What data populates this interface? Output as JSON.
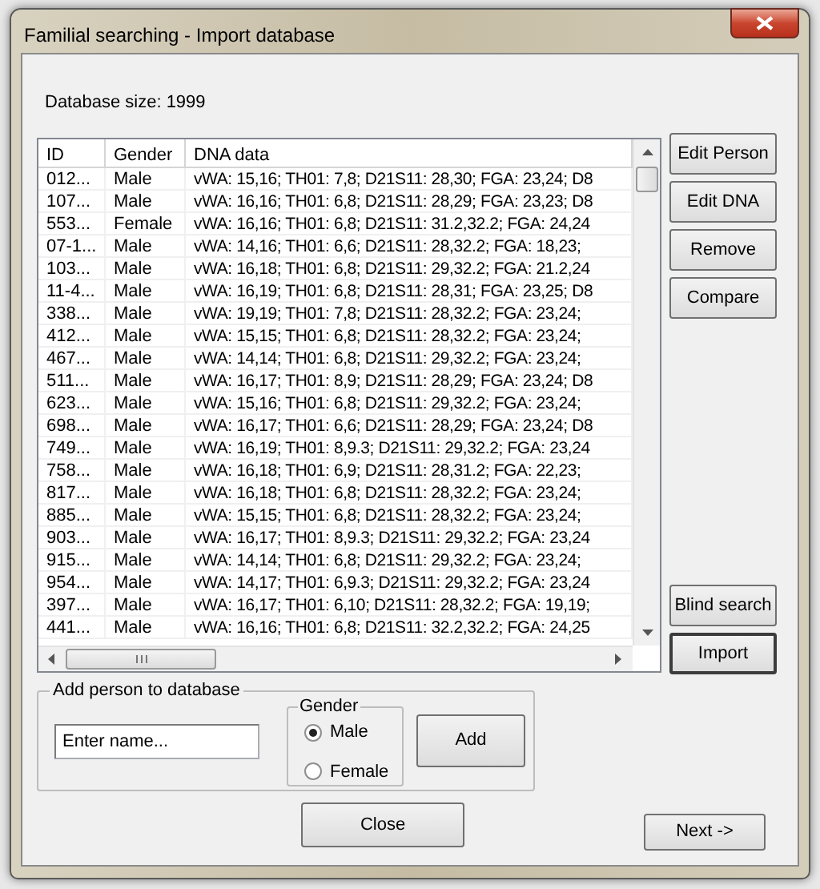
{
  "window": {
    "title": "Familial searching - Import database"
  },
  "database_size": "Database size: 1999",
  "table": {
    "columns": [
      "ID",
      "Gender",
      "DNA data"
    ],
    "rows": [
      [
        "012...",
        "Male",
        "vWA: 15,16; TH01: 7,8; D21S11: 28,30; FGA: 23,24; D8"
      ],
      [
        "107...",
        "Male",
        "vWA: 16,16; TH01: 6,8; D21S11: 28,29; FGA: 23,23; D8"
      ],
      [
        "553...",
        "Female",
        "vWA: 16,16; TH01: 6,8; D21S11: 31.2,32.2; FGA: 24,24"
      ],
      [
        "07-1...",
        "Male",
        "vWA: 14,16; TH01: 6,6; D21S11: 28,32.2; FGA: 18,23;"
      ],
      [
        "103...",
        "Male",
        "vWA: 16,18; TH01: 6,8; D21S11: 29,32.2; FGA: 21.2,24"
      ],
      [
        "11-4...",
        "Male",
        "vWA: 16,19; TH01: 6,8; D21S11: 28,31; FGA: 23,25; D8"
      ],
      [
        "338...",
        "Male",
        "vWA: 19,19; TH01: 7,8; D21S11: 28,32.2; FGA: 23,24;"
      ],
      [
        "412...",
        "Male",
        "vWA: 15,15; TH01: 6,8; D21S11: 28,32.2; FGA: 23,24;"
      ],
      [
        "467...",
        "Male",
        "vWA: 14,14; TH01: 6,8; D21S11: 29,32.2; FGA: 23,24;"
      ],
      [
        "511...",
        "Male",
        "vWA: 16,17; TH01: 8,9; D21S11: 28,29; FGA: 23,24; D8"
      ],
      [
        "623...",
        "Male",
        "vWA: 15,16; TH01: 6,8; D21S11: 29,32.2; FGA: 23,24;"
      ],
      [
        "698...",
        "Male",
        "vWA: 16,17; TH01: 6,6; D21S11: 28,29; FGA: 23,24; D8"
      ],
      [
        "749...",
        "Male",
        "vWA: 16,19; TH01: 8,9.3; D21S11: 29,32.2; FGA: 23,24"
      ],
      [
        "758...",
        "Male",
        "vWA: 16,18; TH01: 6,9; D21S11: 28,31.2; FGA: 22,23;"
      ],
      [
        "817...",
        "Male",
        "vWA: 16,18; TH01: 6,8; D21S11: 28,32.2; FGA: 23,24;"
      ],
      [
        "885...",
        "Male",
        "vWA: 15,15; TH01: 6,8; D21S11: 28,32.2; FGA: 23,24;"
      ],
      [
        "903...",
        "Male",
        "vWA: 16,17; TH01: 8,9.3; D21S11: 29,32.2; FGA: 23,24"
      ],
      [
        "915...",
        "Male",
        "vWA: 14,14; TH01: 6,8; D21S11: 29,32.2; FGA: 23,24;"
      ],
      [
        "954...",
        "Male",
        "vWA: 14,17; TH01: 6,9.3; D21S11: 29,32.2; FGA: 23,24"
      ],
      [
        "397...",
        "Male",
        "vWA: 16,17; TH01: 6,10; D21S11: 28,32.2; FGA: 19,19;"
      ],
      [
        "441...",
        "Male",
        "vWA: 16,16; TH01: 6,8; D21S11: 32.2,32.2; FGA: 24,25"
      ]
    ]
  },
  "side_buttons": [
    {
      "label": "Edit Person",
      "default": false
    },
    {
      "label": "Edit DNA",
      "default": false
    },
    {
      "label": "Remove",
      "default": false
    },
    {
      "label": "Compare",
      "default": false
    },
    {
      "label": "Blind search",
      "default": false
    },
    {
      "label": "Import",
      "default": true
    }
  ],
  "add_person": {
    "title": "Add person to database",
    "name_field": {
      "placeholder": "Enter name..."
    },
    "gender": {
      "title": "Gender",
      "options": [
        {
          "label": "Male",
          "selected": true
        },
        {
          "label": "Female",
          "selected": false
        }
      ]
    },
    "add_button": "Add"
  },
  "buttons": [
    {
      "label": "Close"
    },
    {
      "label": "Next ->"
    }
  ]
}
